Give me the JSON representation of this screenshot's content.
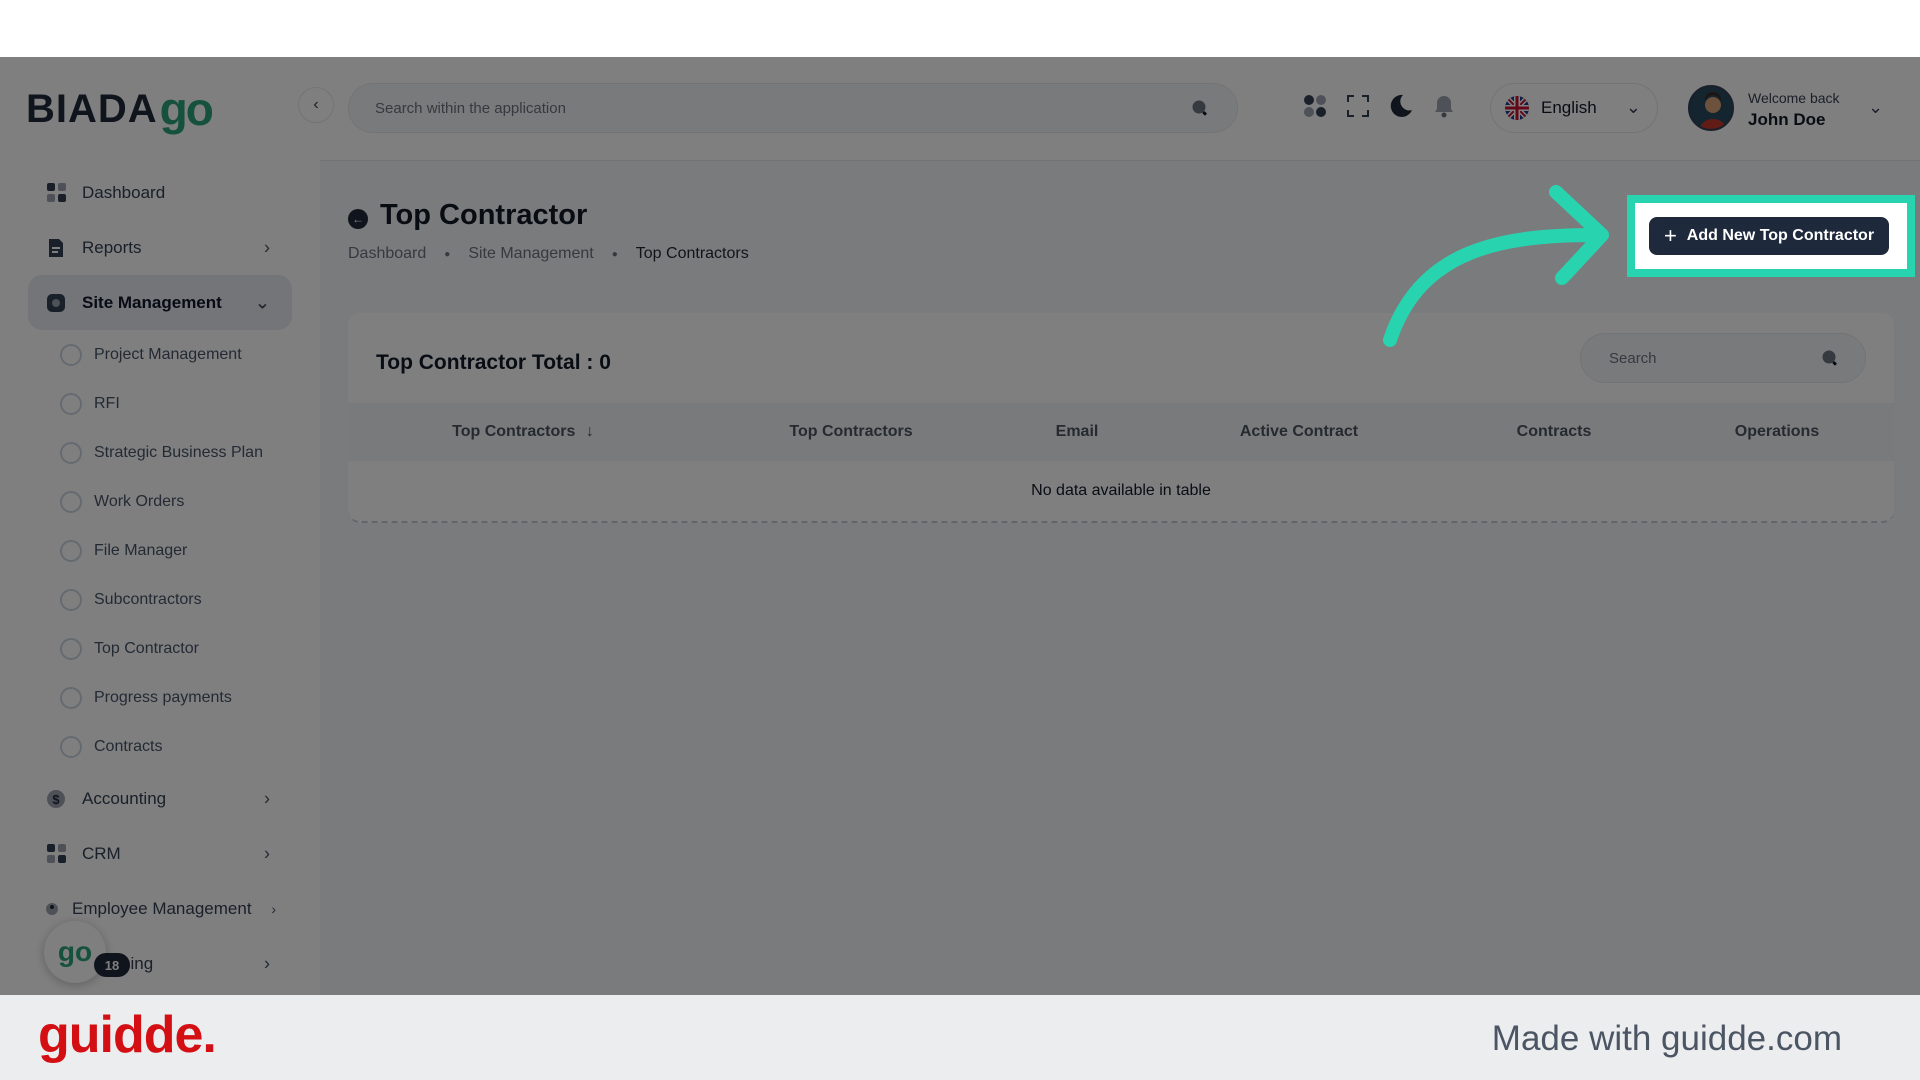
{
  "app": {
    "logo_text": "BIADA",
    "logo_go": "go",
    "float_badge_label": "go",
    "float_badge_count": "18"
  },
  "sidebar": {
    "items": [
      {
        "label": "Dashboard",
        "icon": "grid-icon"
      },
      {
        "label": "Reports",
        "icon": "report-icon"
      },
      {
        "label": "Site Management",
        "icon": "site-icon",
        "active": true
      },
      {
        "label": "Accounting",
        "icon": "dollar-icon"
      },
      {
        "label": "CRM",
        "icon": "grid-icon"
      },
      {
        "label": "Employee Management",
        "icon": "user-icon"
      },
      {
        "label": "sing",
        "icon": "leasing-icon"
      }
    ],
    "sub_items": [
      "Project Management",
      "RFI",
      "Strategic Business Plan",
      "Work Orders",
      "File Manager",
      "Subcontractors",
      "Top Contractor",
      "Progress payments",
      "Contracts"
    ]
  },
  "header": {
    "search_placeholder": "Search within the application",
    "language": "English",
    "welcome": "Welcome back",
    "user_name": "John Doe"
  },
  "page": {
    "title": "Top Contractor",
    "breadcrumbs": [
      "Dashboard",
      "Site Management",
      "Top Contractors"
    ],
    "add_button": "Add New Top Contractor"
  },
  "table": {
    "title": "Top Contractor Total : 0",
    "search_placeholder": "Search",
    "columns": [
      "Top Contractors",
      "Top Contractors",
      "Email",
      "Active Contract",
      "Contracts",
      "Operations"
    ],
    "sort_indicator": "↓",
    "empty_message": "No data available in table"
  },
  "footer": {
    "logo": "guidde.",
    "made_with": "Made with guidde.com"
  },
  "colors": {
    "accent": "#28d4b0",
    "brand_green": "#2aa37a",
    "primary_dark": "#1e293b",
    "guidde_red": "#d40f14"
  }
}
